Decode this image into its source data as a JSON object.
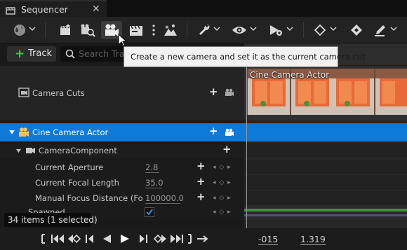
{
  "window": {
    "tab_title": "Sequencer",
    "close_glyph": "✕"
  },
  "toolbar": {
    "items": [
      "globe-icon",
      "cinematic-new-icon",
      "camera-search-icon",
      "camera-icon",
      "clapper-icon",
      "more-vertical-icon",
      "mountain-icon",
      "wrench-icon",
      "eye-icon",
      "play-settings-icon",
      "diamond-icon",
      "key-add-icon",
      "pen-icon"
    ]
  },
  "tooltip": {
    "text": "Create a new camera and set it as the current camera cut"
  },
  "outliner": {
    "add_track_label": "Track",
    "search_placeholder": "Search Tracks",
    "camera_cuts_label": "Camera Cuts",
    "actor_label": "Cine Camera Actor",
    "component_label": "CameraComponent",
    "properties": [
      {
        "label": "Current Aperture",
        "value": "2.8"
      },
      {
        "label": "Current Focal Length",
        "value": "35.0"
      },
      {
        "label": "Manual Focus Distance (Focus",
        "value": "100000.0"
      }
    ],
    "spawned_label": "Spawned",
    "spawned_checked": true
  },
  "timeline": {
    "shot_label": "Cine Camera Actor",
    "start_time": "-015",
    "end_time": "1.319"
  },
  "status": {
    "items_text": "34 items (1 selected)"
  },
  "colors": {
    "accent": "#0d79d9",
    "add_green": "#3dcb3d"
  }
}
